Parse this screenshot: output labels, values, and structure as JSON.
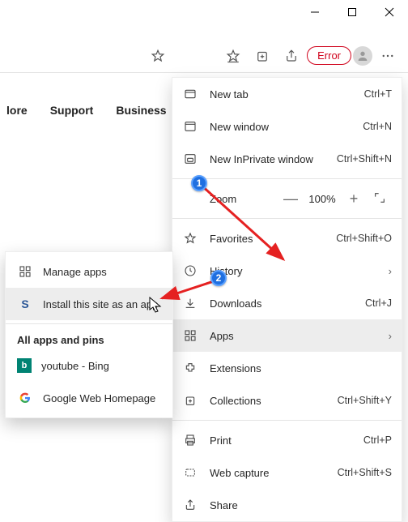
{
  "window": {
    "min": "—",
    "close": "×"
  },
  "toolbar": {
    "error_label": "Error"
  },
  "nav": {
    "items": [
      "lore",
      "Support",
      "Business"
    ]
  },
  "menu": {
    "newTab": {
      "label": "New tab",
      "shortcut": "Ctrl+T"
    },
    "newWindow": {
      "label": "New window",
      "shortcut": "Ctrl+N"
    },
    "newInPrivate": {
      "label": "New InPrivate window",
      "shortcut": "Ctrl+Shift+N"
    },
    "zoom": {
      "label": "Zoom",
      "value": "100%"
    },
    "favorites": {
      "label": "Favorites",
      "shortcut": "Ctrl+Shift+O"
    },
    "history": {
      "label": "History"
    },
    "downloads": {
      "label": "Downloads",
      "shortcut": "Ctrl+J"
    },
    "apps": {
      "label": "Apps"
    },
    "extensions": {
      "label": "Extensions"
    },
    "collections": {
      "label": "Collections",
      "shortcut": "Ctrl+Shift+Y"
    },
    "print": {
      "label": "Print",
      "shortcut": "Ctrl+P"
    },
    "webCapture": {
      "label": "Web capture",
      "shortcut": "Ctrl+Shift+S"
    },
    "share": {
      "label": "Share"
    }
  },
  "submenu": {
    "manage": {
      "label": "Manage apps"
    },
    "install": {
      "label": "Install this site as an app"
    },
    "header": "All apps and pins",
    "items": [
      {
        "label": "youtube - Bing",
        "icon": "bing"
      },
      {
        "label": "Google Web Homepage",
        "icon": "google"
      }
    ]
  },
  "annotations": {
    "arrow_color": "#e52121",
    "badge1": "1",
    "badge2": "2"
  }
}
